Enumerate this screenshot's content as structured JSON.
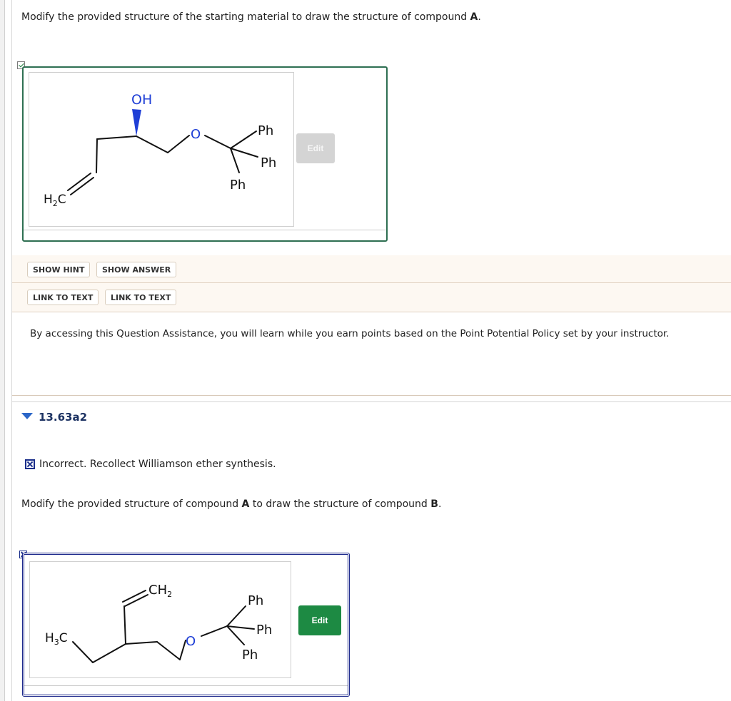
{
  "question1": {
    "prompt_before": "Modify the provided structure of the starting material to draw the structure of compound ",
    "prompt_bold": "A",
    "prompt_after": ".",
    "edit_label": "Edit",
    "molecule_labels": {
      "oh": "OH",
      "o": "O",
      "ph_top": "Ph",
      "ph_right": "Ph",
      "ph_bottom": "Ph",
      "h2c_h": "H",
      "h2c_sub": "2",
      "h2c_c": "C"
    }
  },
  "assistance": {
    "show_hint": "SHOW HINT",
    "show_answer": "SHOW ANSWER",
    "link_to_text_1": "LINK TO TEXT",
    "link_to_text_2": "LINK TO TEXT",
    "policy_text": "By accessing this Question Assistance, you will learn while you earn points based on the Point Potential Policy set by your instructor."
  },
  "question2": {
    "section_title": "13.63a2",
    "feedback": "Incorrect. Recollect Williamson ether synthesis.",
    "prompt_before": "Modify the provided structure of compound ",
    "prompt_bold1": "A",
    "prompt_mid": " to draw the structure of compound ",
    "prompt_bold2": "B",
    "prompt_after": ".",
    "edit_label": "Edit",
    "molecule_labels": {
      "ch2_c": "CH",
      "ch2_sub": "2",
      "h3c_h": "H",
      "h3c_sub": "3",
      "h3c_c": "C",
      "o": "O",
      "ph_top": "Ph",
      "ph_right": "Ph",
      "ph_bottom": "Ph"
    }
  },
  "colors": {
    "correct_frame": "#2e6f52",
    "incorrect_frame": "#1e2a8c",
    "edit_active": "#1d8a43",
    "edit_disabled": "#d4d4d4",
    "heteroatom_blue": "#1f3fd6",
    "section_triangle": "#2b66c8"
  }
}
